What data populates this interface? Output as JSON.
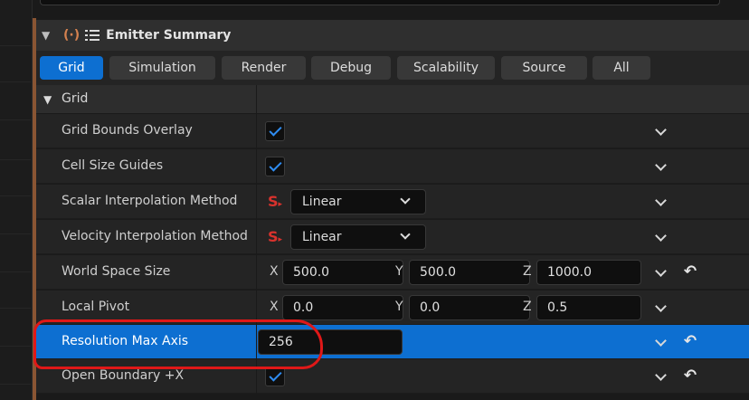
{
  "panel": {
    "title": "Emitter Summary",
    "icons": {
      "collapse": "chevron-down-icon",
      "emitter": "emitter-icon",
      "list": "list-icon"
    }
  },
  "tabs": [
    {
      "label": "Grid",
      "active": true
    },
    {
      "label": "Simulation",
      "active": false
    },
    {
      "label": "Render",
      "active": false
    },
    {
      "label": "Debug",
      "active": false
    },
    {
      "label": "Scalability",
      "active": false
    },
    {
      "label": "Source",
      "active": false
    },
    {
      "label": "All",
      "active": false
    }
  ],
  "section": {
    "label": "Grid"
  },
  "rows": {
    "grid_bounds_overlay": {
      "label": "Grid Bounds Overlay",
      "checked": true
    },
    "cell_size_guides": {
      "label": "Cell Size Guides",
      "checked": true
    },
    "scalar_interp": {
      "label": "Scalar Interpolation Method",
      "value": "Linear"
    },
    "velocity_interp": {
      "label": "Velocity Interpolation Method",
      "value": "Linear"
    },
    "world_space_size": {
      "label": "World Space Size",
      "x_label": "X",
      "x": "500.0",
      "y_label": "Y",
      "y": "500.0",
      "z_label": "Z",
      "z": "1000.0"
    },
    "local_pivot": {
      "label": "Local Pivot",
      "x_label": "X",
      "x": "0.0",
      "y_label": "Y",
      "y": "0.0",
      "z_label": "Z",
      "z": "0.5"
    },
    "resolution_max_axis": {
      "label": "Resolution Max Axis",
      "value": "256",
      "selected": true
    },
    "open_boundary_x": {
      "label": "Open Boundary +X",
      "checked": true
    }
  },
  "colors": {
    "accent": "#0d6fd1",
    "emitter_accent": "#8a5533",
    "annotation": "#e01818"
  }
}
